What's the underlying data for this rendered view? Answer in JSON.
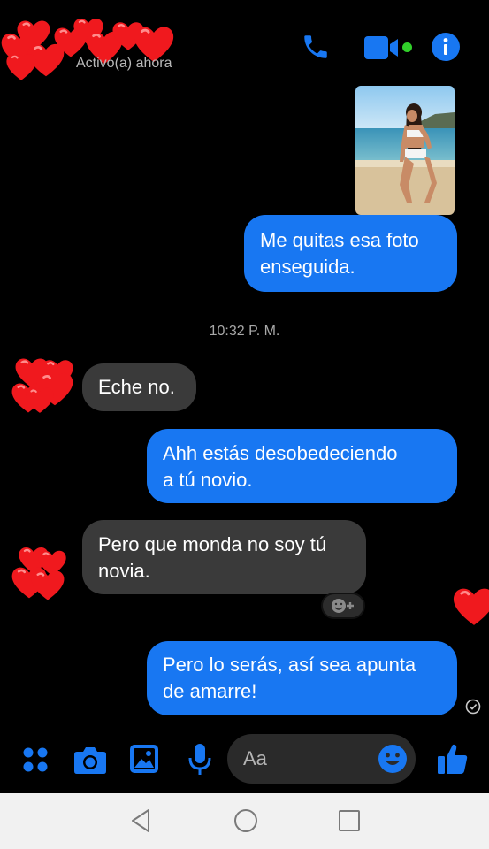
{
  "header": {
    "status": "Activo(a) ahora",
    "icons": [
      "phone-icon",
      "video-icon",
      "info-icon"
    ],
    "active_color": "#31d02a"
  },
  "messages": [
    {
      "type": "image",
      "side": "out",
      "description_icon": "photo-thumbnail"
    },
    {
      "type": "text",
      "side": "out",
      "lines": [
        "Me quitas esa foto",
        "enseguida."
      ]
    },
    {
      "type": "timestamp",
      "text": "10:32 P. M."
    },
    {
      "type": "text",
      "side": "in",
      "lines": [
        "Eche no."
      ]
    },
    {
      "type": "text",
      "side": "out",
      "lines": [
        "Ahh estás desobedeciendo",
        "a tú novio."
      ]
    },
    {
      "type": "text",
      "side": "in",
      "lines": [
        "Pero que monda no soy tú",
        "novia."
      ]
    },
    {
      "type": "text",
      "side": "out",
      "lines": [
        "Pero lo serás, así sea apunta",
        "de amarre!"
      ]
    }
  ],
  "composer": {
    "placeholder": "Aa",
    "icons": [
      "apps-grid-icon",
      "camera-icon",
      "gallery-icon",
      "microphone-icon",
      "emoji-icon",
      "thumbs-up-icon"
    ]
  },
  "colors": {
    "accent": "#1877f2",
    "incoming_bubble": "#3a3a3a",
    "heart": "#f0191e"
  },
  "navbar": {
    "icons": [
      "back-icon",
      "home-icon",
      "recents-icon"
    ]
  }
}
